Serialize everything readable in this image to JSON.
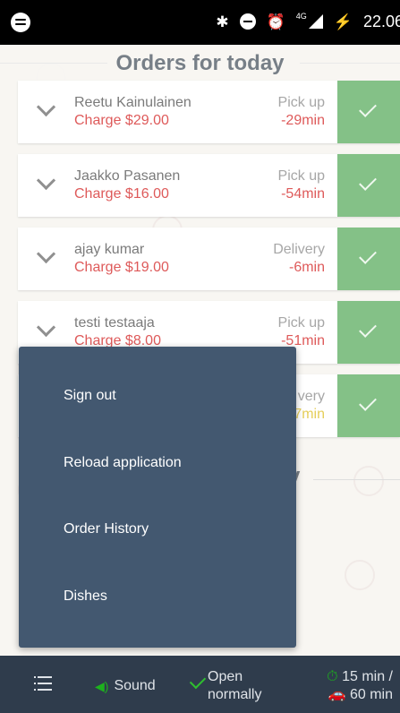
{
  "status_bar": {
    "icons": [
      "spotify-icon",
      "bluetooth-icon",
      "do-not-disturb-icon",
      "alarm-icon",
      "signal-4g-icon",
      "charging-icon"
    ],
    "network": "4G",
    "time": "22.06"
  },
  "page": {
    "title": "Orders for today",
    "section_partial": "y"
  },
  "orders": [
    {
      "name": "Reetu Kainulainen",
      "charge": "Charge $29.00",
      "type": "Pick up",
      "eta": "-29min"
    },
    {
      "name": "Jaakko Pasanen",
      "charge": "Charge $16.00",
      "type": "Pick up",
      "eta": "-54min"
    },
    {
      "name": "ajay kumar",
      "charge": "Charge $19.00",
      "type": "Delivery",
      "eta": "-6min"
    },
    {
      "name": "testi testaaja",
      "charge": "Charge $8.00",
      "type": "Pick up",
      "eta": "-51min"
    },
    {
      "name": "",
      "charge": "",
      "type": "very",
      "eta": "7min"
    }
  ],
  "menu": {
    "items": [
      "Sign out",
      "Reload application",
      "Order History",
      "Dishes"
    ]
  },
  "bottom_bar": {
    "sound_label": "Sound",
    "open_line1": "Open",
    "open_line2": "normally",
    "pickup_time": "15 min /",
    "delivery_time": "60 min"
  },
  "colors": {
    "accept_green": "#43a047",
    "charge_red": "#cc0000",
    "menu_bg": "#435870",
    "bottom_bar_bg": "#2f3c4c"
  }
}
